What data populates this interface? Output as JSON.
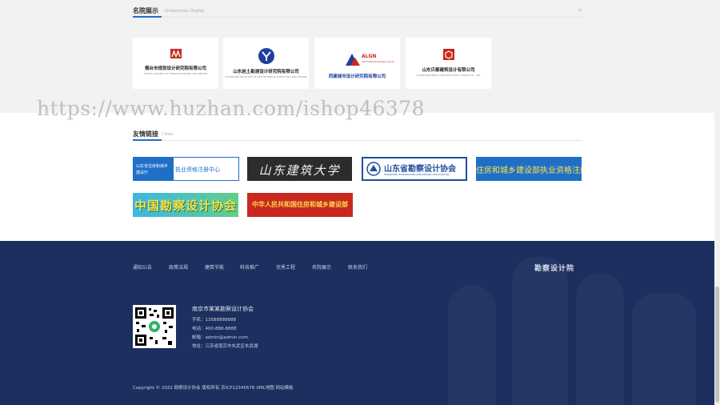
{
  "enterprise": {
    "title": "名院展示",
    "subtitle": "Enterprises Display",
    "more_icon": "double-chevron-right-icon",
    "items": [
      {
        "name": "烟台市规划设计研究院有限公司",
        "sub": "YANTAI ACADEMY OF URBAN PLANNING AND DESIGN",
        "color": "#c8281e"
      },
      {
        "name": "山东岩土勘测设计研究院有限公司",
        "sub": "SHANDONG INSTITUTE OF GEOTECHNICAL SURVEYING AND DESIGN",
        "color": "#1e3f9c"
      },
      {
        "name": "西建城市设计研究院有限公司",
        "sub": "",
        "color": "#1e3f9c",
        "brand": "ALGN",
        "brand_sub": "International Design Group"
      },
      {
        "name": "山东贝都建筑设计有限公司",
        "sub": "SHANDONG BEIDU ARCHITECTURAL DESIGN CO., LTD",
        "color": "#c8281e"
      }
    ]
  },
  "watermark": "https://www.huzhan.com/ishop46378",
  "links": {
    "title": "友情链接",
    "subtitle": "links",
    "items": [
      {
        "left": "山东省住房和城乡建设厅",
        "right": "执业资格注册中心"
      },
      {
        "text": "山东建筑大学"
      },
      {
        "text": "山东省勘察设计协会",
        "en": "SHANDONG EXPLORATION AND DESIGN ASSOCIATION",
        "abbr": "SEDA"
      },
      {
        "text": "住房和城乡建设部执业资格注册中心"
      },
      {
        "text": "中国勘察设计协会"
      },
      {
        "text": "中华人民共和国住房和城乡建设部"
      }
    ]
  },
  "footer": {
    "nav": [
      "通知公告",
      "政策法规",
      "建筑节能",
      "科技推广",
      "优秀工程",
      "名院展示",
      "联系我们"
    ],
    "brand": "勘察设计院",
    "qr_icon": "qr-code-icon",
    "org": "南京市某某勘察设计协会",
    "phone": "手机：13588888888",
    "tel": "电话：400-888-8888",
    "email": "邮箱：admin@admin.com",
    "address": "地址：江苏省南京市玄武区玄武湖",
    "copyright": "Copyright © 2022 勘察设计协会 版权所有  苏ICP12345678  XML地图  网站模板"
  }
}
